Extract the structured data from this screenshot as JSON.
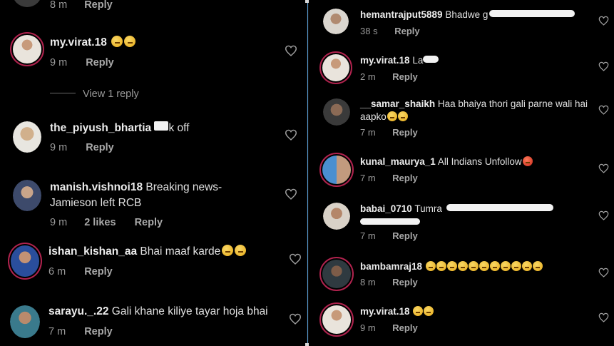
{
  "left": {
    "top_partial": {
      "time": "8 m",
      "reply": "Reply"
    },
    "view_replies": "View 1 reply",
    "comments": [
      {
        "username": "my.virat.18",
        "text": "",
        "emoji_count": 2,
        "time": "9 m",
        "reply": "Reply",
        "likes": ""
      },
      {
        "username": "the_piyush_bhartia",
        "text": "k off",
        "emoji_count": 0,
        "time": "9 m",
        "reply": "Reply",
        "likes": ""
      },
      {
        "username": "manish.vishnoi18",
        "text": "Breaking news-Jamieson left RCB",
        "emoji_count": 0,
        "time": "9 m",
        "reply": "Reply",
        "likes": "2 likes"
      },
      {
        "username": "ishan_kishan_aa",
        "text": "Bhai maaf karde",
        "emoji_count": 2,
        "time": "6 m",
        "reply": "Reply",
        "likes": ""
      },
      {
        "username": "sarayu._.22",
        "text": "Gali khane kiliye tayar hoja bhai",
        "emoji_count": 0,
        "time": "7 m",
        "reply": "Reply",
        "likes": ""
      }
    ]
  },
  "right": {
    "comments": [
      {
        "username": "hemantrajput5889",
        "text": "Bhadwe g",
        "emoji_count": 0,
        "time": "38 s",
        "reply": "Reply"
      },
      {
        "username": "my.virat.18",
        "text": "La",
        "emoji_count": 0,
        "time": "2 m",
        "reply": "Reply"
      },
      {
        "username": "__samar_shaikh",
        "text": "Haa bhaiya thori gali parne wali hai aapko",
        "emoji_count": 2,
        "time": "7 m",
        "reply": "Reply"
      },
      {
        "username": "kunal_maurya_1",
        "text": "All Indians Unfollow",
        "emoji_count": 1,
        "time": "7 m",
        "reply": "Reply"
      },
      {
        "username": "babai_0710",
        "text": "Tumra",
        "emoji_count": 0,
        "time": "7 m",
        "reply": "Reply"
      },
      {
        "username": "bambamraj18",
        "text": "",
        "emoji_count": 11,
        "time": "8 m",
        "reply": "Reply"
      },
      {
        "username": "my.virat.18",
        "text": "",
        "emoji_count": 2,
        "time": "9 m",
        "reply": "Reply"
      }
    ]
  },
  "icons": {
    "like": "heart-outline-icon",
    "emoji": "face-emoji-icon"
  },
  "colors": {
    "background": "#000000",
    "story_ring": "#b0234e",
    "secondary_text": "#9a9a9a",
    "divider": "#5aa0d8"
  }
}
